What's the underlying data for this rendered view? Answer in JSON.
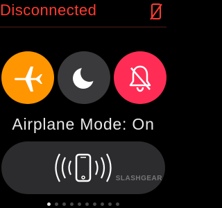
{
  "status": {
    "text": "Disconnected",
    "color": "#ff3b30",
    "icon": "phone-disconnected-icon"
  },
  "toggles": [
    {
      "id": "airplane",
      "icon": "airplane-icon",
      "color": "#ff9500",
      "state": "on"
    },
    {
      "id": "do-not-disturb",
      "icon": "moon-icon",
      "color": "#3a3a3c",
      "state": "off"
    },
    {
      "id": "silent",
      "icon": "bell-slash-icon",
      "color": "#ff2d55",
      "state": "on"
    }
  ],
  "mode_label": "Airplane Mode: On",
  "ping_button": {
    "icon": "ping-phone-icon",
    "background": "#2c2c2e"
  },
  "watermark": "SLASHGEAR",
  "pagination": {
    "total": 10,
    "current": 1
  }
}
